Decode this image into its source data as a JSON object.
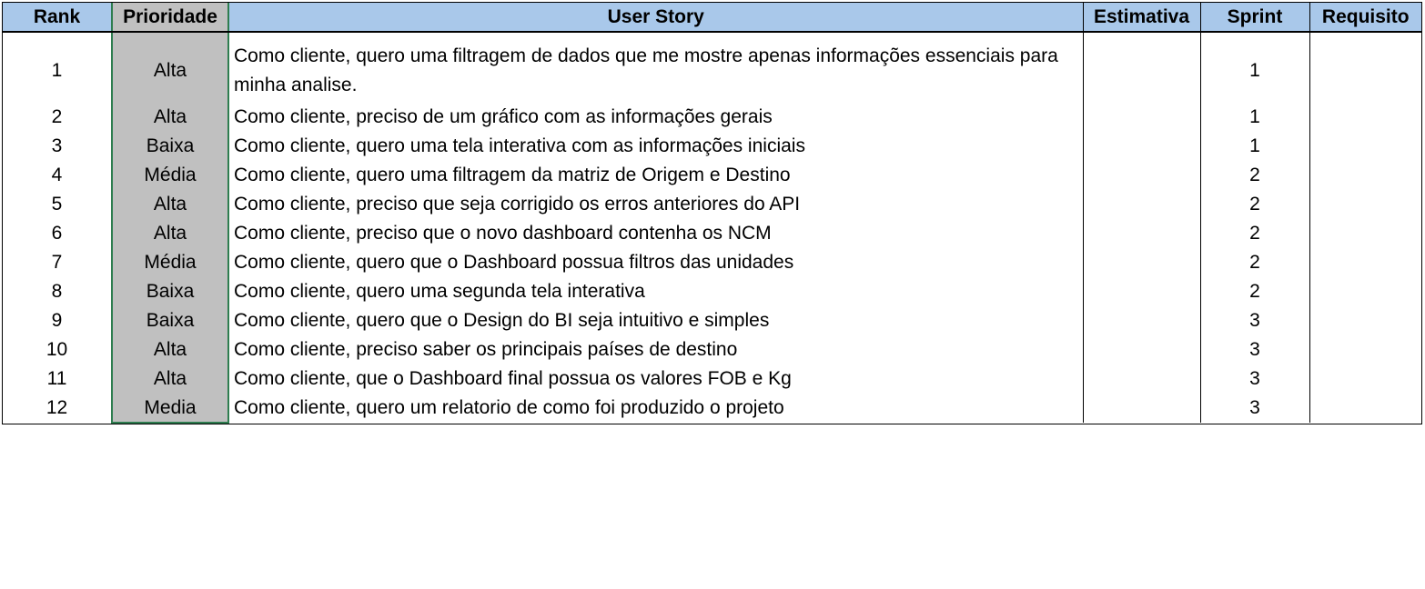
{
  "colors": {
    "header_background": "#a9c8ea",
    "priority_column_background": "#c0c0c0",
    "priority_column_border": "#2e7d4f",
    "grid_line": "#000000"
  },
  "table": {
    "headers": {
      "rank": "Rank",
      "priority": "Prioridade",
      "story": "User Story",
      "estimate": "Estimativa",
      "sprint": "Sprint",
      "requirement": "Requisito"
    },
    "rows": [
      {
        "rank": "1",
        "priority": "Alta",
        "story": "Como cliente, quero uma filtragem de dados que me mostre apenas informações essenciais para minha analise.",
        "estimate": "",
        "sprint": "1",
        "requirement": ""
      },
      {
        "rank": "2",
        "priority": "Alta",
        "story": "Como cliente, preciso de um gráfico com as informações gerais",
        "estimate": "",
        "sprint": "1",
        "requirement": ""
      },
      {
        "rank": "3",
        "priority": "Baixa",
        "story": "Como cliente, quero uma tela interativa com as informações iniciais",
        "estimate": "",
        "sprint": "1",
        "requirement": ""
      },
      {
        "rank": "4",
        "priority": "Média",
        "story": "Como cliente, quero uma filtragem da matriz de Origem e Destino",
        "estimate": "",
        "sprint": "2",
        "requirement": ""
      },
      {
        "rank": "5",
        "priority": "Alta",
        "story": "Como cliente, preciso que seja corrigido os erros anteriores do API",
        "estimate": "",
        "sprint": "2",
        "requirement": ""
      },
      {
        "rank": "6",
        "priority": "Alta",
        "story": "Como cliente, preciso que o novo dashboard contenha os NCM",
        "estimate": "",
        "sprint": "2",
        "requirement": ""
      },
      {
        "rank": "7",
        "priority": "Média",
        "story": "Como cliente, quero que o Dashboard possua filtros das unidades",
        "estimate": "",
        "sprint": "2",
        "requirement": ""
      },
      {
        "rank": "8",
        "priority": "Baixa",
        "story": "Como cliente, quero uma segunda tela interativa",
        "estimate": "",
        "sprint": "2",
        "requirement": ""
      },
      {
        "rank": "9",
        "priority": "Baixa",
        "story": "Como cliente, quero que o Design do BI seja intuitivo e simples",
        "estimate": "",
        "sprint": "3",
        "requirement": ""
      },
      {
        "rank": "10",
        "priority": "Alta",
        "story": "Como cliente, preciso saber os principais países de destino",
        "estimate": "",
        "sprint": "3",
        "requirement": ""
      },
      {
        "rank": "11",
        "priority": "Alta",
        "story": "Como cliente, que o Dashboard final possua os valores FOB e Kg",
        "estimate": "",
        "sprint": "3",
        "requirement": ""
      },
      {
        "rank": "12",
        "priority": "Media",
        "story": "Como cliente, quero um relatorio de como foi produzido o projeto",
        "estimate": "",
        "sprint": "3",
        "requirement": ""
      }
    ]
  }
}
